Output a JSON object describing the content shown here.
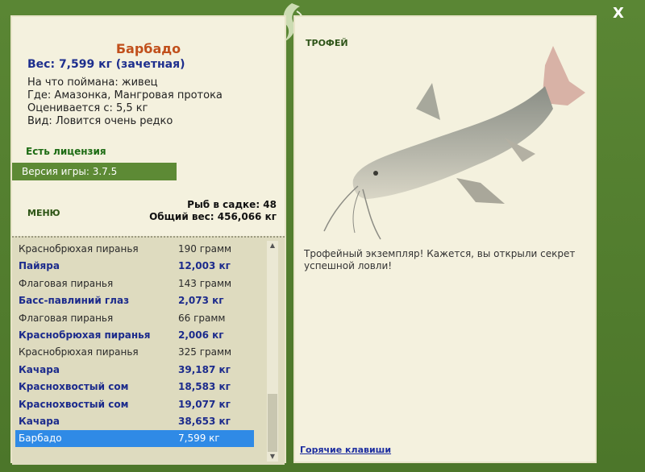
{
  "window": {
    "close_label": "X"
  },
  "fish": {
    "name": "Барбадо",
    "weight": "Вес: 7,599 кг (зачетная)",
    "caught_with": "На что поймана: живец",
    "where": "Где: Амазонка, Мангровая протока",
    "value": "Оценивается с: 5,5 кг",
    "kind": "Вид: Ловится очень редко"
  },
  "license": "Есть лицензия",
  "version": "Версия игры: 3.7.5",
  "menu_label": "МЕНЮ",
  "stats": {
    "fish_in_keepnet": "Рыб в садке: 48",
    "total_weight": "Общий вес: 456,066 кг"
  },
  "catch_list": [
    {
      "name": "Краснобрюхая пиранья",
      "weight": "190 грамм",
      "trophy": false
    },
    {
      "name": "Пайяра",
      "weight": "12,003 кг",
      "trophy": true
    },
    {
      "name": "Флаговая пиранья",
      "weight": "143 грамм",
      "trophy": false
    },
    {
      "name": "Басс-павлиний глаз",
      "weight": "2,073 кг",
      "trophy": true
    },
    {
      "name": "Флаговая пиранья",
      "weight": "66 грамм",
      "trophy": false
    },
    {
      "name": "Краснобрюхая пиранья",
      "weight": "2,006 кг",
      "trophy": true
    },
    {
      "name": "Краснобрюхая пиранья",
      "weight": "325 грамм",
      "trophy": false
    },
    {
      "name": "Качара",
      "weight": "39,187 кг",
      "trophy": true
    },
    {
      "name": "Краснохвостый сом",
      "weight": "18,583 кг",
      "trophy": true
    },
    {
      "name": "Краснохвостый сом",
      "weight": "19,077 кг",
      "trophy": true
    },
    {
      "name": "Качара",
      "weight": "38,653 кг",
      "trophy": true
    },
    {
      "name": "Барбадо",
      "weight": "7,599 кг",
      "trophy": true,
      "selected": true
    }
  ],
  "trophy": {
    "label": "ТРОФЕЙ",
    "description": "Трофейный экземпляр! Кажется, вы открыли секрет успешной ловли!"
  },
  "hotkeys_label": "Горячие клавиши",
  "colors": {
    "frame": "#4f7a2c",
    "panel": "#f4f1de",
    "selection": "#2f8ae6",
    "trophy_text": "#1c2b8c",
    "title": "#c1501c"
  }
}
